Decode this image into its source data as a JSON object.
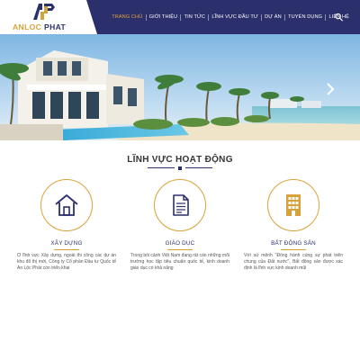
{
  "logo": {
    "text_part1": "ANLOC",
    "text_part2": "PHAT",
    "icon": "anlocphat-logo-icon"
  },
  "nav": {
    "items": [
      {
        "label": "TRANG CHỦ",
        "active": true
      },
      {
        "label": "GIỚI THIỆU",
        "active": false
      },
      {
        "label": "TIN TỨC",
        "active": false
      },
      {
        "label": "LĨNH VỰC ĐẦU TƯ",
        "active": false
      },
      {
        "label": "DỰ ÁN",
        "active": false
      },
      {
        "label": "TUYỂN DỤNG",
        "active": false
      },
      {
        "label": "LIÊN HỆ",
        "active": false
      }
    ],
    "search_icon": "search-icon"
  },
  "banner": {
    "next_icon": "chevron-right-icon"
  },
  "section": {
    "title": "LĨNH VỰC HOẠT ĐỘNG"
  },
  "cards": [
    {
      "icon": "house-icon",
      "title": "XÂY DỰNG",
      "text": "Ở lĩnh vực Xây dựng, ngoài thi công các dự án khu đô thị mới, Công ty Cổ phần Đầu tư Quốc tế An Lộc Phát còn triển khai"
    },
    {
      "icon": "document-icon",
      "title": "GIÁO DỤC",
      "text": "Trong bối cảnh Việt Nam đang rất cần những môi trường học tập tiêu chuẩn quốc tế, kinh doanh giáo dục có khả năng"
    },
    {
      "icon": "building-icon",
      "title": "BẤT ĐỘNG SẢN",
      "text": "Với sứ mệnh \"Đồng hành cùng sự phát triển chung của Đất nước\", Bất động sản được xác định là lĩnh vực kinh doanh mũi"
    }
  ],
  "colors": {
    "navy": "#2b2f6b",
    "gold": "#d8a23a",
    "active_nav": "#e3a43a"
  }
}
